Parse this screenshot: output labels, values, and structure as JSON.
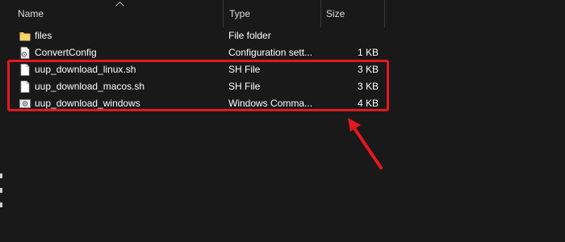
{
  "columns": {
    "name": "Name",
    "type": "Type",
    "size": "Size"
  },
  "files": [
    {
      "name": "files",
      "type": "File folder",
      "size": "",
      "icon": "folder-icon"
    },
    {
      "name": "ConvertConfig",
      "type": "Configuration sett...",
      "size": "1 KB",
      "icon": "config-file-icon"
    },
    {
      "name": "uup_download_linux.sh",
      "type": "SH File",
      "size": "3 KB",
      "icon": "document-icon"
    },
    {
      "name": "uup_download_macos.sh",
      "type": "SH File",
      "size": "3 KB",
      "icon": "document-icon"
    },
    {
      "name": "uup_download_windows",
      "type": "Windows Comma...",
      "size": "4 KB",
      "icon": "batch-file-icon"
    }
  ],
  "annotation": {
    "color": "#e4181f"
  },
  "colors": {
    "background": "#191919",
    "folder": "#f2c14e",
    "highlight": "#e4181f"
  }
}
